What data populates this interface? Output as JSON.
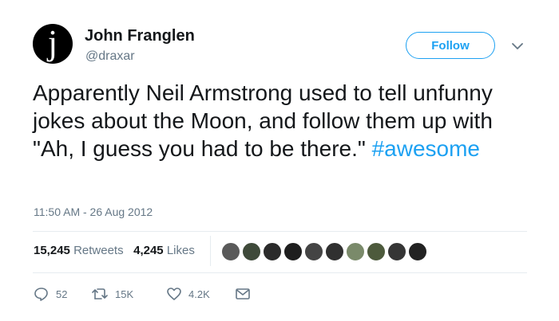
{
  "author": {
    "avatar_glyph": "j",
    "name": "John Franglen",
    "handle": "@draxar"
  },
  "follow_label": "Follow",
  "tweet": {
    "text": "Apparently Neil Armstrong used to tell unfunny jokes about the Moon, and follow them up with \"Ah, I guess you had to be there.\" ",
    "hashtag": "#awesome"
  },
  "timestamp": "11:50 AM - 26 Aug 2012",
  "stats": {
    "retweets_count": "15,245",
    "retweets_label": "Retweets",
    "likes_count": "4,245",
    "likes_label": "Likes"
  },
  "liker_avatar_colors": [
    "#5a5a5a",
    "#3f4a3a",
    "#2b2b2b",
    "#1e1e1e",
    "#444444",
    "#303030",
    "#7a8a6a",
    "#4d5a3c",
    "#353535",
    "#222222"
  ],
  "actions": {
    "reply_count": "52",
    "retweet_count": "15K",
    "like_count": "4.2K"
  },
  "colors": {
    "accent": "#1da1f2",
    "secondary_text": "#657786",
    "primary_text": "#14171a"
  }
}
